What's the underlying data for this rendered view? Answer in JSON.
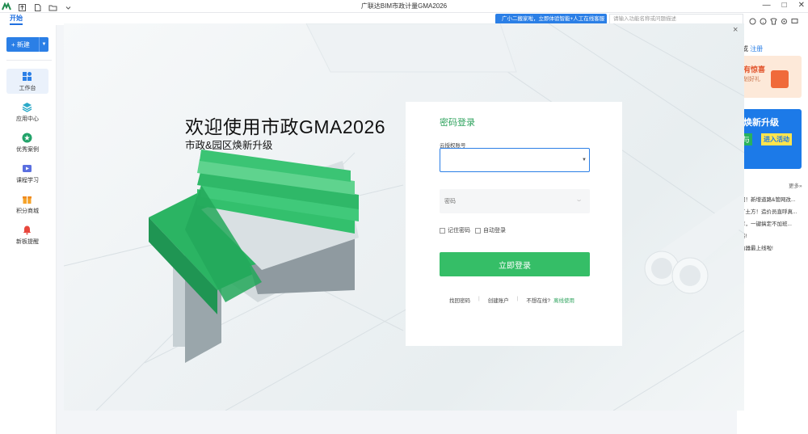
{
  "window": {
    "title": "广联达BIM市政计量GMA2026",
    "controls": [
      "—",
      "□",
      "✕"
    ]
  },
  "topbar": {
    "start_tab": "开始",
    "promo": "广小二搬家啦，立即体验智能+人工在线客服",
    "search_placeholder": "请输入功能名称或问题描述"
  },
  "sidebar": {
    "new_button": "+ 新建",
    "items": [
      {
        "label": "工作台",
        "icon": "workbench-icon",
        "active": true
      },
      {
        "label": "应用中心",
        "icon": "app-center-icon",
        "active": false
      },
      {
        "label": "优秀案例",
        "icon": "star-icon",
        "active": false
      },
      {
        "label": "课程学习",
        "icon": "video-icon",
        "active": false
      },
      {
        "label": "积分商城",
        "icon": "gift-icon",
        "active": false
      },
      {
        "label": "新板提醒",
        "icon": "bell-icon",
        "active": false
      }
    ]
  },
  "right_panel": {
    "login_prefix": "或",
    "register": "注册",
    "banner1_title": "有惊喜",
    "banner1_sub": "划好礼",
    "banner2_title": "焕新升级",
    "banner2_tag1": "与",
    "banner2_tag2": "进入活动",
    "more": "更多»",
    "news": [
      "门！新增道路&管网改...",
      "了土方！造价员直呼真...",
      "享，一键搞定不加班...",
      "惑!",
      "冶器最上线啦!"
    ]
  },
  "modal": {
    "close": "×",
    "welcome": "欢迎使用市政GMA2026",
    "subtitle": "市政&园区焕新升级"
  },
  "login": {
    "title": "密码登录",
    "account_label": "云授权账号",
    "account_value": "",
    "password_placeholder": "密码",
    "remember": "记住密码",
    "auto_login": "自动登录",
    "submit": "立即登录",
    "forgot": "找回密码",
    "create": "创建账户",
    "not_online": "不想在线?",
    "offline_use": "离线使用"
  },
  "colors": {
    "accent_blue": "#2b7fe6",
    "brand_green": "#35be67"
  }
}
